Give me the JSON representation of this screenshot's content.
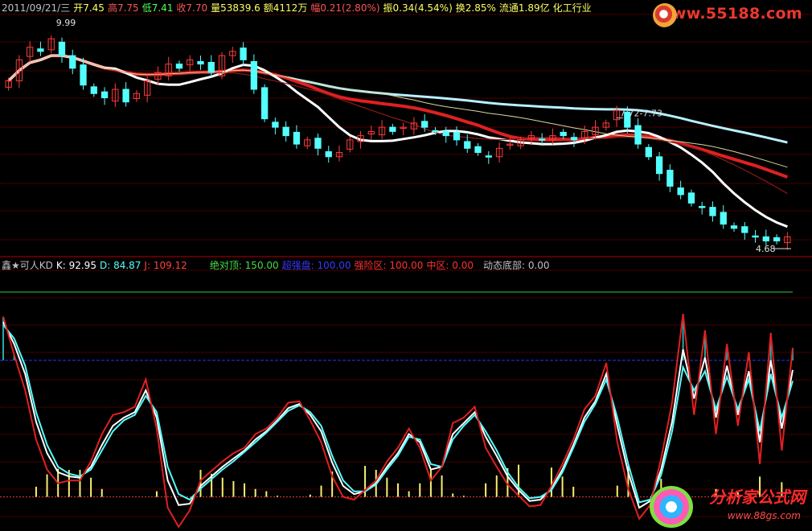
{
  "header": {
    "date": "2011/09/21/三",
    "open": "开7.45",
    "high": "高7.75",
    "low": "低7.41",
    "close": "收7.70",
    "volume": "量53839.6",
    "amount": "额4112万",
    "change": "幅0.21(2.80%)",
    "amplitude": "振0.34(4.54%)",
    "turnover": "换2.85%",
    "float": "流通1.89亿",
    "industry": "化工行业"
  },
  "indicator": {
    "name": "鑫★可人KD",
    "k": "K: 92.95",
    "d": "D: 84.87",
    "j": "J: 109.12",
    "abs_top": "绝对顶: 150.00",
    "ultra_strong": "超强盘: 100.00",
    "strong_zone": "强险区: 100.00",
    "middle": "中区: 0.00",
    "dyn_bottom": "动态底部: 0.00"
  },
  "watermarks": {
    "top": "www.55188.com",
    "bottom": "分析家公式网",
    "bottom_url": "www.88gs.com"
  },
  "colors": {
    "up": "#ff3b3b",
    "down": "#54ffff",
    "grid": "#8b0000",
    "k_line": "#ffffff",
    "d_line": "#54ffff",
    "j_line": "#e02020",
    "abs_top_line": "#2fd02f",
    "ultra_line": "#3030ff",
    "yellow_bars": "#f6f070"
  },
  "chart_data": [
    {
      "type": "candlestick",
      "title": "",
      "annotations": {
        "high_label": "9.99",
        "mid_label": "7.72-7.73",
        "low_label": "4.68"
      },
      "price_range": [
        4.6,
        10.1
      ],
      "close": [
        8.6,
        9.1,
        9.4,
        9.3,
        9.6,
        9.2,
        8.9,
        8.5,
        8.3,
        8.2,
        8.4,
        8.1,
        8.3,
        8.6,
        8.8,
        9.0,
        8.9,
        9.1,
        9.0,
        8.8,
        9.2,
        9.3,
        9.1,
        8.4,
        7.7,
        7.5,
        7.3,
        7.1,
        7.2,
        7.0,
        6.8,
        6.9,
        7.2,
        7.3,
        7.4,
        7.5,
        7.4,
        7.5,
        7.6,
        7.5,
        7.4,
        7.3,
        7.2,
        7.0,
        6.9,
        6.8,
        7.0,
        7.1,
        7.2,
        7.3,
        7.2,
        7.3,
        7.3,
        7.2,
        7.4,
        7.5,
        7.6,
        7.9,
        7.5,
        7.1,
        6.8,
        6.4,
        6.1,
        5.9,
        5.7,
        5.6,
        5.4,
        5.2,
        5.1,
        5.0,
        4.9,
        4.8,
        4.8,
        4.9
      ],
      "ma_lines": [
        "white",
        "red",
        "light-cyan",
        "dark-red",
        "pale-yellow"
      ]
    },
    {
      "type": "line",
      "title": "",
      "ylim": [
        -25,
        160
      ],
      "reference_lines": {
        "abs_top": 150,
        "ultra_strong": 100,
        "strong_zone": 100,
        "middle": 0,
        "dyn_bottom": 0
      },
      "series": [
        {
          "name": "K",
          "values": [
            128,
            112,
            90,
            55,
            32,
            18,
            15,
            14,
            22,
            38,
            52,
            58,
            62,
            78,
            58,
            12,
            -6,
            -5,
            8,
            15,
            22,
            28,
            34,
            42,
            48,
            56,
            65,
            68,
            60,
            48,
            25,
            8,
            2,
            4,
            10,
            22,
            32,
            46,
            40,
            20,
            22,
            46,
            54,
            62,
            44,
            30,
            15,
            5,
            -3,
            -2,
            6,
            20,
            38,
            58,
            70,
            90,
            52,
            18,
            -8,
            -3,
            20,
            55,
            108,
            72,
            102,
            58,
            96,
            60,
            92,
            40,
            100,
            50,
            92.95
          ]
        },
        {
          "name": "D",
          "values": [
            126,
            116,
            96,
            62,
            38,
            22,
            17,
            15,
            20,
            34,
            48,
            56,
            60,
            74,
            62,
            22,
            2,
            -2,
            6,
            13,
            20,
            26,
            33,
            40,
            47,
            55,
            63,
            67,
            62,
            52,
            30,
            12,
            4,
            4,
            9,
            20,
            30,
            44,
            42,
            24,
            22,
            42,
            52,
            60,
            48,
            34,
            18,
            7,
            -1,
            0,
            5,
            18,
            36,
            55,
            68,
            86,
            58,
            24,
            -4,
            -2,
            16,
            48,
            95,
            78,
            92,
            64,
            88,
            64,
            86,
            48,
            90,
            58,
            84.87
          ]
        },
        {
          "name": "J",
          "values": [
            132,
            104,
            78,
            42,
            20,
            10,
            12,
            12,
            26,
            46,
            60,
            62,
            66,
            86,
            50,
            -8,
            -22,
            -10,
            12,
            19,
            26,
            32,
            36,
            46,
            50,
            58,
            69,
            70,
            56,
            40,
            15,
            0,
            -2,
            5,
            12,
            26,
            36,
            50,
            36,
            12,
            22,
            54,
            58,
            66,
            36,
            22,
            9,
            1,
            -7,
            -6,
            8,
            24,
            42,
            64,
            74,
            98,
            40,
            6,
            -16,
            -6,
            28,
            69,
            134,
            60,
            122,
            46,
            112,
            52,
            106,
            24,
            120,
            34,
            109.12
          ]
        }
      ]
    }
  ]
}
